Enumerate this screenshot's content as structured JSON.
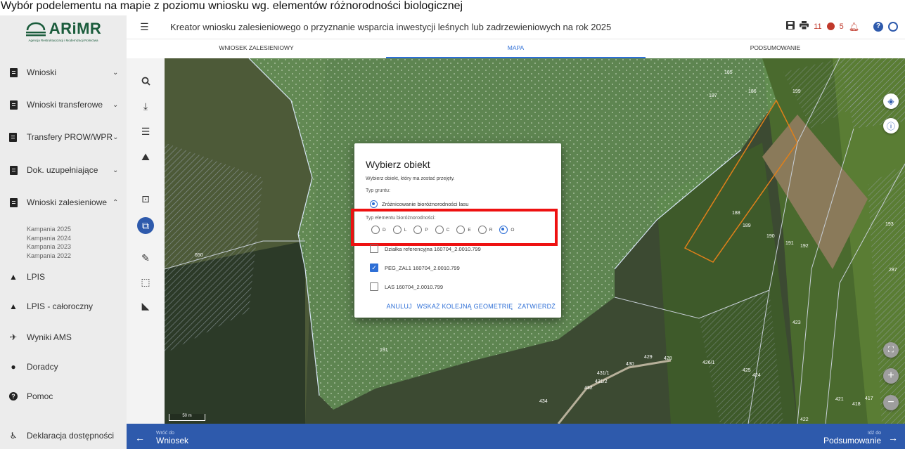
{
  "caption": "Wybór podelementu na mapie z poziomu wniosku wg. elementów różnorodności biologicznej",
  "sidebar": {
    "logo_text": "ARiMR",
    "logo_sub": "Agencja Restrukturyzacji i Modernizacji Rolnictwa",
    "items": [
      {
        "label": "Wnioski",
        "icon": "clipboard-icon",
        "chev": "⌄"
      },
      {
        "label": "Wnioski transferowe",
        "icon": "clipboard-icon",
        "chev": "⌄"
      },
      {
        "label": "Transfery PROW/WPR",
        "icon": "clipboard-icon",
        "chev": "⌄"
      },
      {
        "label": "Dok. uzupełniające",
        "icon": "clipboard-icon",
        "chev": "⌄"
      },
      {
        "label": "Wnioski zalesieniowe",
        "icon": "clipboard-icon",
        "chev": "⌃"
      },
      {
        "label": "LPIS",
        "icon": "mountain-icon",
        "chev": ""
      },
      {
        "label": "LPIS - całoroczny",
        "icon": "mountain-icon",
        "chev": ""
      },
      {
        "label": "Wyniki AMS",
        "icon": "satellite-icon",
        "chev": ""
      },
      {
        "label": "Doradcy",
        "icon": "user-icon",
        "chev": ""
      },
      {
        "label": "Pomoc",
        "icon": "help-icon",
        "chev": ""
      },
      {
        "label": "Deklaracja dostępności",
        "icon": "accessibility-icon",
        "chev": ""
      }
    ],
    "sub_items": [
      "Kampania 2025",
      "Kampania 2024",
      "Kampania 2023",
      "Kampania 2022"
    ]
  },
  "topbar": {
    "title": "Kreator wniosku zalesieniowego o przyznanie wsparcia inwestycji leśnych lub zadrzewieniowych na rok 2025",
    "count_errors": "11",
    "count_alerts": "5"
  },
  "tabs": [
    {
      "label": "WNIOSEK ZALESIENIOWY",
      "active": false
    },
    {
      "label": "MAPA",
      "active": true
    },
    {
      "label": "PODSUMOWANIE",
      "active": false
    }
  ],
  "map": {
    "scale_label": "50 m",
    "parcel_labels": [
      "185",
      "186",
      "187",
      "199",
      "188",
      "189",
      "190",
      "191",
      "192",
      "193",
      "287",
      "650",
      "423",
      "429",
      "428",
      "426/1",
      "430",
      "431/1",
      "431/2",
      "432",
      "425",
      "424",
      "421",
      "417",
      "418",
      "422",
      "434",
      "191"
    ]
  },
  "dialog": {
    "title": "Wybierz obiekt",
    "subtitle": "Wybierz obiekt, który ma zostać przejęty.",
    "ground_type_label": "Typ gruntu:",
    "ground_type_option": "Zróżnicowanie bioróżnorodności lasu",
    "bio_type_label": "Typ elementu bioróżnorodności:",
    "bio_options": [
      {
        "label": "D",
        "checked": false
      },
      {
        "label": "L",
        "checked": false
      },
      {
        "label": "P",
        "checked": false
      },
      {
        "label": "C",
        "checked": false
      },
      {
        "label": "E",
        "checked": false
      },
      {
        "label": "R",
        "checked": false
      },
      {
        "label": "O",
        "checked": true
      }
    ],
    "checkboxes": [
      {
        "label": "Działka referencyjna 160704_2.0010.799",
        "checked": false
      },
      {
        "label": "PEG_ZAL1 160704_2.0010.799",
        "checked": true
      },
      {
        "label": "LAS 160704_2.0010.799",
        "checked": false
      }
    ],
    "actions": {
      "cancel": "ANULUJ",
      "next": "WSKAŻ KOLEJNĄ GEOMETRIĘ",
      "confirm": "ZATWIERDŹ"
    }
  },
  "bottombar": {
    "back_small": "Wróć do",
    "back_big": "Wniosek",
    "next_small": "Idź do",
    "next_big": "Podsumowanie"
  },
  "colors": {
    "primary": "#2e5aac",
    "accent": "#2e6fd6",
    "highlight": "#ee1111",
    "logo": "#1b5c3c"
  }
}
